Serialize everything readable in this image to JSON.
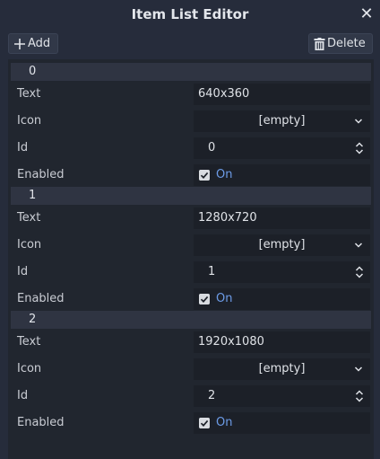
{
  "window": {
    "title": "Item List Editor",
    "close_glyph": "✕"
  },
  "toolbar": {
    "add_label": "Add",
    "delete_label": "Delete"
  },
  "labels": {
    "text": "Text",
    "icon": "Icon",
    "id": "Id",
    "enabled": "Enabled"
  },
  "items": [
    {
      "header": "0",
      "text": "640x360",
      "icon": "[empty]",
      "id": "0",
      "enabled_label": "On",
      "enabled": true
    },
    {
      "header": "1",
      "text": "1280x720",
      "icon": "[empty]",
      "id": "1",
      "enabled_label": "On",
      "enabled": true
    },
    {
      "header": "2",
      "text": "1920x1080",
      "icon": "[empty]",
      "id": "2",
      "enabled_label": "On",
      "enabled": true
    }
  ],
  "icons": {
    "add": "plus-icon",
    "delete": "trash-icon",
    "close": "close-icon",
    "select": "chevron-down-icon",
    "spin": "spinner-arrows-icon",
    "check": "checkbox-icon"
  },
  "colors": {
    "window_bg": "#262c3b",
    "panel_bg": "#21262f",
    "header_bg": "#2f3442",
    "field_bg": "#1c2028",
    "accent": "#6d9ce8"
  }
}
